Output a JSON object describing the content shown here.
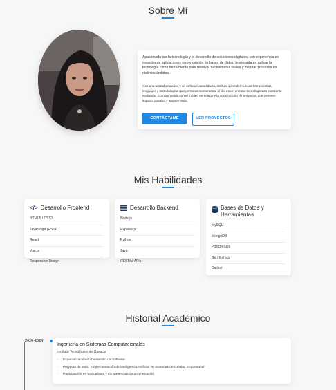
{
  "about": {
    "title": "Sobre Mí",
    "paragraph1": "Apasionada por la tecnología y el desarrollo de soluciones digitales, con experiencia en creación de aplicaciones web y gestión de bases de datos. Interesada en aplicar la tecnología como herramienta para resolver necesidades reales y mejorar procesos en distintos ámbitos.",
    "paragraph2": "Con una actitud proactiva y un enfoque autodidacta, disfruto aprender nuevas herramientas, lenguajes y metodologías que permitan mantenerme al día en un entorno tecnológico en constante evolución. Comprometida con el trabajo en equipo y la construcción de proyectos que generen impacto positivo y aporten valor.",
    "contact_label": "Contáctame",
    "projects_label": "Ver proyectos"
  },
  "skills": {
    "title": "Mis Habilidades",
    "cards": [
      {
        "icon": "code-icon",
        "title": "Desarrollo Frontend",
        "items": [
          "HTML5 / CSS3",
          "JavaScript (ES6+)",
          "React",
          "Vue.js",
          "Responsive Design"
        ]
      },
      {
        "icon": "server-icon",
        "title": "Desarrollo Backend",
        "items": [
          "Node.js",
          "Express.js",
          "Python",
          "Java",
          "RESTful APIs"
        ]
      },
      {
        "icon": "database-icon",
        "title": "Bases de Datos y Herramientas",
        "items": [
          "MySQL",
          "MongoDB",
          "PostgreSQL",
          "Git / GitHub",
          "Docker"
        ]
      }
    ]
  },
  "history": {
    "title": "Historial Académico",
    "entries": [
      {
        "date": "2020-2024",
        "degree": "Ingeniería en Sistemas Computacionales",
        "institution": "Instituto Tecnológico de Oaxaca",
        "bullets": [
          "Especialización en Desarrollo de Software",
          "Proyecto de tesis: \"Implementación de Inteligencia Artificial en Sistemas de Gestión Empresarial\"",
          "Participación en hackathons y competencias de programación"
        ]
      }
    ]
  },
  "colors": {
    "accent": "#1e88e5",
    "background": "#f7f7f8",
    "card": "#ffffff"
  }
}
